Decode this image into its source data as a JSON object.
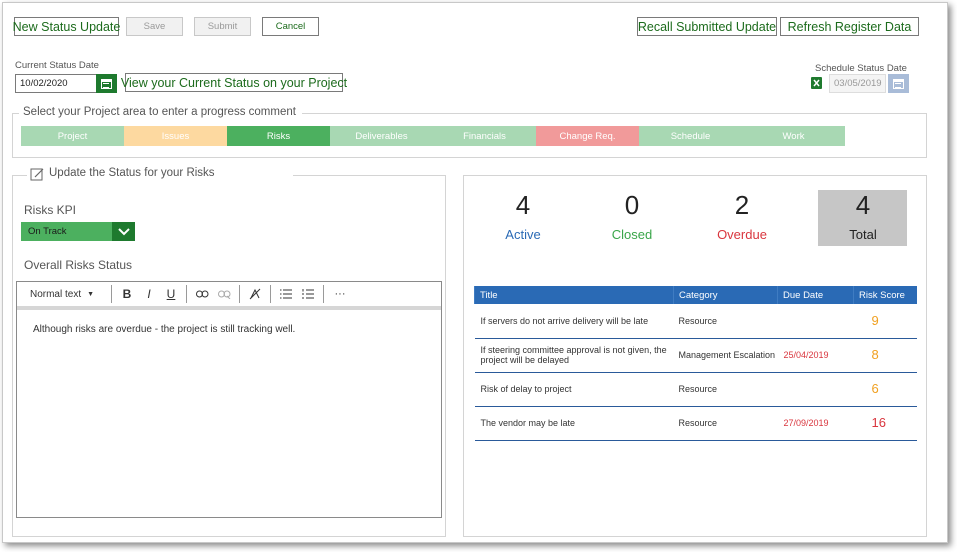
{
  "toolbar": {
    "new_status_update": "New Status Update",
    "save": "Save",
    "submit": "Submit",
    "cancel": "Cancel",
    "recall": "Recall Submitted Update",
    "refresh": "Refresh Register Data"
  },
  "status_date": {
    "label": "Current Status Date",
    "value": "10/02/2020",
    "view_button": "View your Current Status on your Project"
  },
  "schedule_date": {
    "label": "Schedule Status Date",
    "value": "03/05/2019"
  },
  "project_area": {
    "legend": "Select your Project area to enter a progress comment",
    "tabs": [
      {
        "label": "Project",
        "color": "#a8d8b3"
      },
      {
        "label": "Issues",
        "color": "#fdd9a0"
      },
      {
        "label": "Risks",
        "color": "#4cb05f"
      },
      {
        "label": "Deliverables",
        "color": "#a8d8b3"
      },
      {
        "label": "Financials",
        "color": "#a8d8b3"
      },
      {
        "label": "Change Req.",
        "color": "#f19a9a"
      },
      {
        "label": "Schedule",
        "color": "#a8d8b3"
      },
      {
        "label": "Work",
        "color": "#a8d8b3"
      }
    ]
  },
  "update_panel": {
    "legend": "Update the Status for your Risks",
    "kpi_label": "Risks KPI",
    "kpi_value": "On Track",
    "overall_label": "Overall Risks Status",
    "editor": {
      "style_select": "Normal text",
      "bold": "B",
      "italic": "I",
      "underline": "U",
      "more": "···",
      "content": "Although risks are overdue - the project is still tracking well."
    }
  },
  "summary": {
    "active": {
      "value": "4",
      "label": "Active",
      "color": "#2a6ab5"
    },
    "closed": {
      "value": "0",
      "label": "Closed",
      "color": "#3aa64a"
    },
    "overdue": {
      "value": "2",
      "label": "Overdue",
      "color": "#d9363e"
    },
    "total": {
      "value": "4",
      "label": "Total",
      "color": "#222222"
    }
  },
  "risks_table": {
    "columns": [
      "Title",
      "Category",
      "Due Date",
      "Risk Score"
    ],
    "rows": [
      {
        "title": "If servers do not arrive delivery will be late",
        "category": "Resource",
        "due": "",
        "score": "9",
        "score_color": "#f0a020"
      },
      {
        "title": "If steering committee approval is not given, the project will be delayed",
        "category": "Management Escalation",
        "due": "25/04/2019",
        "score": "8",
        "score_color": "#f0a020"
      },
      {
        "title": "Risk of delay to project",
        "category": "Resource",
        "due": "",
        "score": "6",
        "score_color": "#f0a020"
      },
      {
        "title": "The vendor may be late",
        "category": "Resource",
        "due": "27/09/2019",
        "score": "16",
        "score_color": "#d9363e"
      }
    ]
  }
}
